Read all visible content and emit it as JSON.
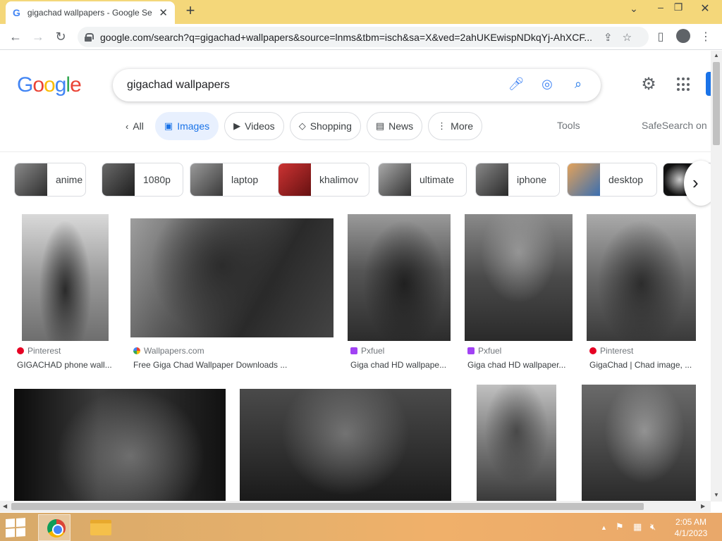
{
  "browser": {
    "tab_title": "gigachad wallpapers - Google Se",
    "tab_close": "✕",
    "new_tab": "+",
    "url": "google.com/search?q=gigachad+wallpapers&source=lnms&tbm=isch&sa=X&ved=2ahUKEwispNDkqYj-AhXCF...",
    "window_controls": {
      "dropdown": "⌄",
      "minimize": "–",
      "restore": "❐",
      "close": "✕"
    }
  },
  "google": {
    "query": "gigachad wallpapers",
    "logo_letters": [
      "G",
      "o",
      "o",
      "g",
      "l",
      "e"
    ],
    "logo_colors": [
      "#4285f4",
      "#ea4335",
      "#fbbc05",
      "#4285f4",
      "#34a853",
      "#ea4335"
    ],
    "filters": [
      {
        "label": "All",
        "icon": "chevron-left-icon",
        "glyph": "‹"
      },
      {
        "label": "Images",
        "icon": "image-icon",
        "glyph": "▣"
      },
      {
        "label": "Videos",
        "icon": "video-icon",
        "glyph": "▶"
      },
      {
        "label": "Shopping",
        "icon": "tag-icon",
        "glyph": "◇"
      },
      {
        "label": "News",
        "icon": "news-icon",
        "glyph": "▤"
      },
      {
        "label": "More",
        "icon": "more-vert-icon",
        "glyph": "⋮"
      }
    ],
    "tools": "Tools",
    "safesearch": "SafeSearch on",
    "related": [
      "anime",
      "1080p",
      "laptop",
      "khalimov",
      "ultimate",
      "iphone",
      "desktop"
    ]
  },
  "results": [
    {
      "source": "Pinterest",
      "caption": "GIGACHAD phone wall...",
      "source_color": "#e60023"
    },
    {
      "source": "Wallpapers.com",
      "caption": "Free Giga Chad Wallpaper Downloads ...",
      "source_color": "#f29900"
    },
    {
      "source": "Pxfuel",
      "caption": "Giga chad HD wallpape...",
      "source_color": "#a142f4"
    },
    {
      "source": "Pxfuel",
      "caption": "Giga chad HD wallpaper...",
      "source_color": "#a142f4"
    },
    {
      "source": "Pinterest",
      "caption": "GigaChad | Chad image, ...",
      "source_color": "#e60023"
    }
  ],
  "taskbar": {
    "time": "2:05 AM",
    "date": "4/1/2023"
  }
}
